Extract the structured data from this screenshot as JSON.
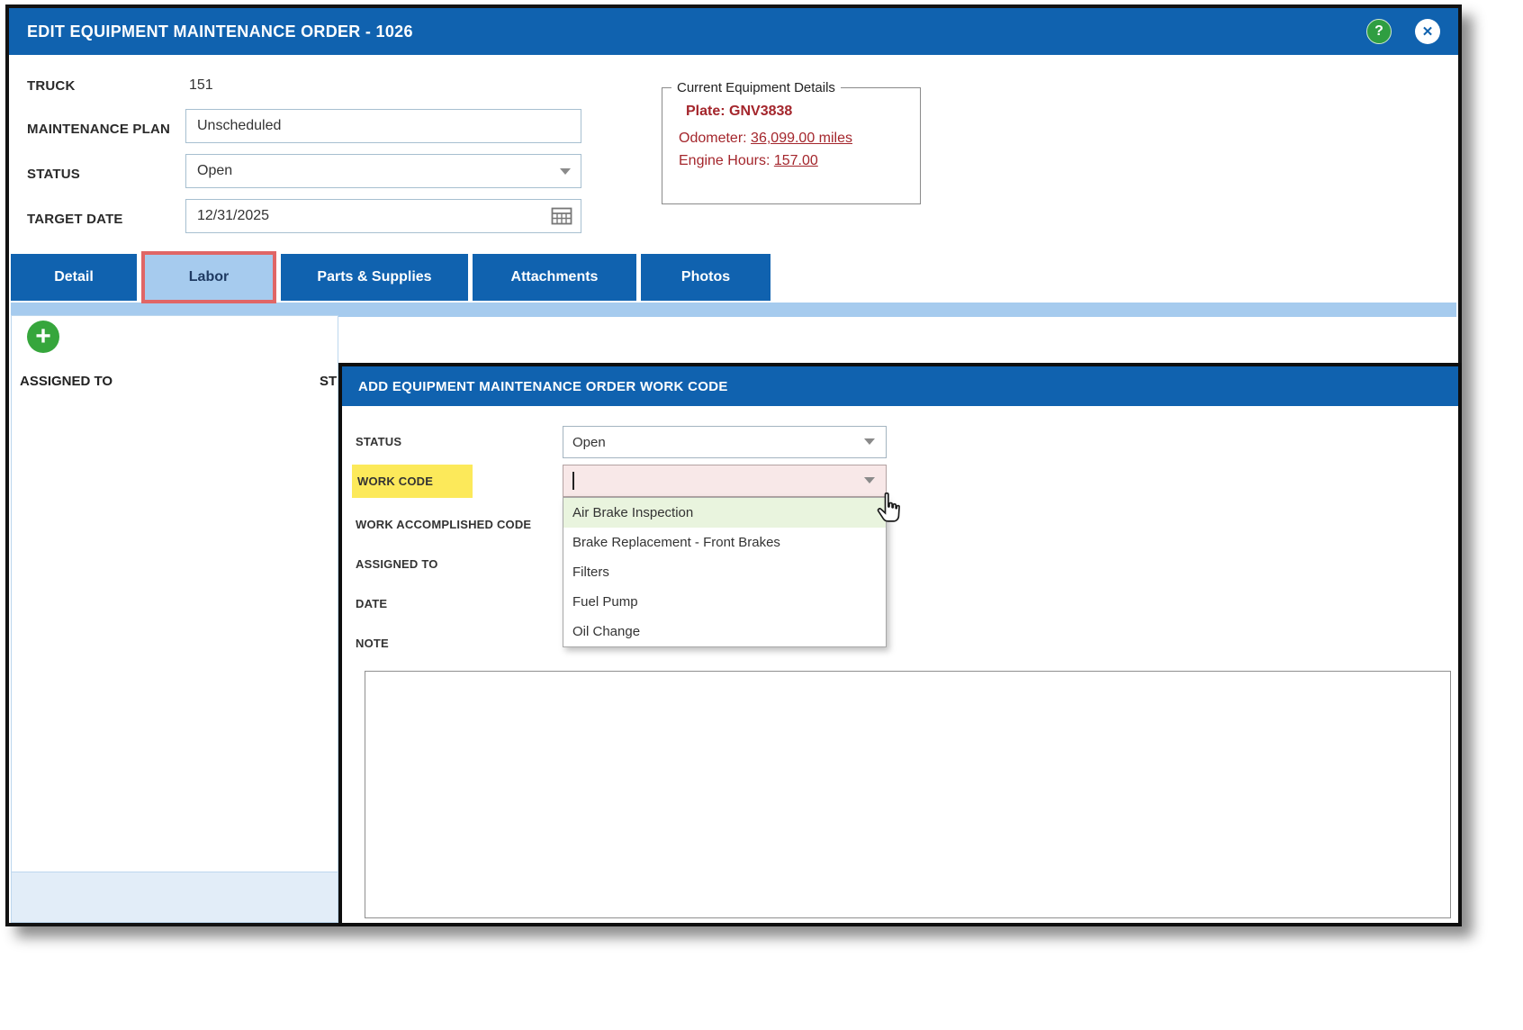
{
  "window": {
    "title": "EDIT EQUIPMENT MAINTENANCE ORDER - 1026",
    "help_icon": "?",
    "close_icon": "✕"
  },
  "form": {
    "truck_label": "TRUCK",
    "truck_value": "151",
    "maintenance_plan_label": "MAINTENANCE PLAN",
    "maintenance_plan_value": "Unscheduled",
    "status_label": "STATUS",
    "status_value": "Open",
    "target_date_label": "TARGET DATE",
    "target_date_value": "12/31/2025"
  },
  "equipment_details": {
    "legend": "Current Equipment Details",
    "plate_label": "Plate:",
    "plate_value": "GNV3838",
    "odometer_label": "Odometer:",
    "odometer_value": "36,099.00 miles",
    "engine_hours_label": "Engine Hours:",
    "engine_hours_value": "157.00"
  },
  "tabs": [
    {
      "label": "Detail"
    },
    {
      "label": "Labor"
    },
    {
      "label": "Parts & Supplies"
    },
    {
      "label": "Attachments"
    },
    {
      "label": "Photos"
    }
  ],
  "labor_panel": {
    "add_icon": "+",
    "columns": [
      "ASSIGNED TO",
      "ST"
    ]
  },
  "modal": {
    "title": "ADD EQUIPMENT MAINTENANCE ORDER WORK CODE",
    "status_label": "STATUS",
    "status_value": "Open",
    "work_code_label": "WORK CODE",
    "work_code_value": "",
    "work_accomplished_label": "WORK ACCOMPLISHED CODE",
    "assigned_to_label": "ASSIGNED TO",
    "date_label": "DATE",
    "note_label": "NOTE",
    "note_value": "",
    "work_code_options": [
      {
        "label": "Air Brake Inspection",
        "highlighted": true
      },
      {
        "label": "Brake Replacement - Front Brakes",
        "highlighted": false
      },
      {
        "label": "Filters",
        "highlighted": false
      },
      {
        "label": "Fuel Pump",
        "highlighted": false
      },
      {
        "label": "Oil Change",
        "highlighted": false
      }
    ]
  },
  "colors": {
    "titlebar_blue": "#1062AF",
    "active_tab_blue": "#A6CBEE",
    "highlight_red_border": "#E06666",
    "highlight_yellow": "#FCE95A",
    "maroon_text": "#A4262C",
    "work_code_input_bg": "#F8E8E8",
    "option_highlight_green": "#E9F4DE",
    "add_button_green": "#36A63C"
  }
}
